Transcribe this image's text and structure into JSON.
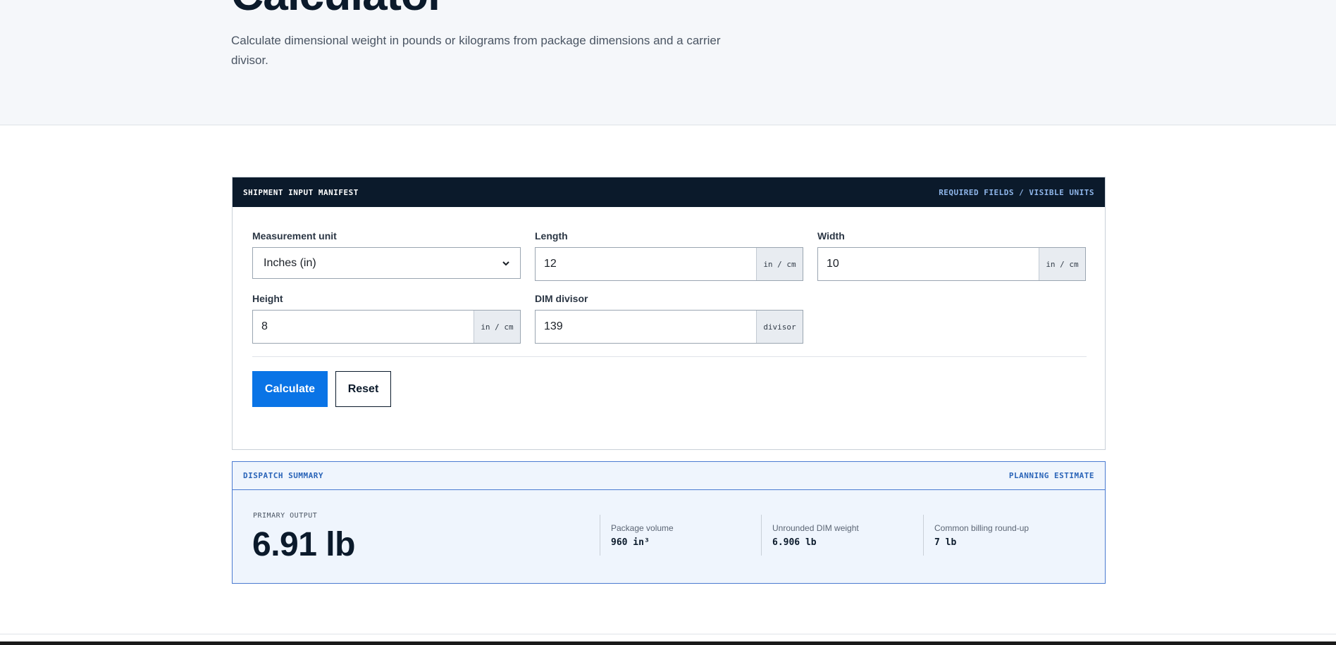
{
  "hero": {
    "title": "Calculator",
    "description": "Calculate dimensional weight in pounds or kilograms from package dimensions and a carrier divisor."
  },
  "manifest": {
    "header_left": "SHIPMENT INPUT MANIFEST",
    "header_right": "REQUIRED FIELDS / VISIBLE UNITS",
    "fields": {
      "unit": {
        "label": "Measurement unit",
        "value": "Inches (in)"
      },
      "length": {
        "label": "Length",
        "value": "12",
        "unit": "in / cm"
      },
      "width": {
        "label": "Width",
        "value": "10",
        "unit": "in / cm"
      },
      "height": {
        "label": "Height",
        "value": "8",
        "unit": "in / cm"
      },
      "divisor": {
        "label": "DIM divisor",
        "value": "139",
        "unit": "divisor"
      }
    },
    "calculate_label": "Calculate",
    "reset_label": "Reset"
  },
  "summary": {
    "header_left": "DISPATCH SUMMARY",
    "header_right": "PLANNING ESTIMATE",
    "primary_label": "PRIMARY OUTPUT",
    "primary_value": "6.91 lb",
    "metrics": [
      {
        "label": "Package volume",
        "value": "960 in³"
      },
      {
        "label": "Unrounded DIM weight",
        "value": "6.906 lb"
      },
      {
        "label": "Common billing round-up",
        "value": "7 lb"
      }
    ]
  },
  "colors": {
    "accent": "#0a74e6",
    "dark": "#0b1a2b",
    "summary_border": "#4a7bd1",
    "summary_bg": "#eff5fd"
  }
}
